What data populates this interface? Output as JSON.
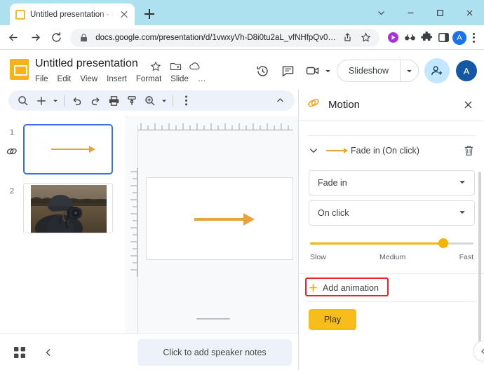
{
  "browser": {
    "tab": {
      "title": "Untitled presentation - Google S",
      "favicon_icon": "slides-favicon",
      "close_icon": "close-icon"
    },
    "new_tab_icon": "plus-icon",
    "window_controls": [
      {
        "name": "tab-search",
        "icon": "chevron-down-icon"
      },
      {
        "name": "minimize",
        "icon": "minimize-icon"
      },
      {
        "name": "maximize",
        "icon": "maximize-icon"
      },
      {
        "name": "close",
        "icon": "close-icon"
      }
    ],
    "nav": {
      "back_icon": "arrow-left-icon",
      "forward_icon": "arrow-right-icon",
      "reload_icon": "reload-icon"
    },
    "omnibox": {
      "lock_icon": "lock-icon",
      "url": "docs.google.com/presentation/d/1vwxyVh-D8i0tu2aL_vfNHfpQv0…",
      "share_icon": "share-icon",
      "bookmark_icon": "star-icon"
    },
    "extensions": [
      {
        "name": "media-extension",
        "icon": "play-circle-icon",
        "color": "#a730e0"
      },
      {
        "name": "accessibility-extension",
        "icon": "glasses-icon",
        "color": "#3c4043"
      },
      {
        "name": "extensions-puzzle",
        "icon": "puzzle-icon",
        "color": "#3c4043"
      },
      {
        "name": "side-panel",
        "icon": "panel-icon",
        "color": "#3c4043"
      }
    ],
    "profile_avatar": "A",
    "menu_icon": "kebab-icon"
  },
  "app_header": {
    "logo_icon": "google-slides-logo",
    "doc_title": "Untitled presentation",
    "title_icons": [
      {
        "name": "star-icon",
        "label": "Star"
      },
      {
        "name": "move-to-folder-icon",
        "label": "Move"
      },
      {
        "name": "cloud-saved-icon",
        "label": "Saved to Drive"
      }
    ],
    "menus": [
      "File",
      "Edit",
      "View",
      "Insert",
      "Format",
      "Slide",
      "…"
    ],
    "right_icons": [
      {
        "name": "version-history-icon",
        "label": "Version history"
      },
      {
        "name": "comment-icon",
        "label": "Comments"
      },
      {
        "name": "meet-camera-icon",
        "label": "Join a call"
      }
    ],
    "slideshow": {
      "label": "Slideshow",
      "dropdown_icon": "chevron-down-icon"
    },
    "share_button": {
      "name": "share-button",
      "icon": "person-add-icon"
    },
    "account_avatar": "A"
  },
  "slides_toolbar": {
    "items": [
      {
        "name": "search-icon",
        "label": "Search the menus"
      },
      {
        "name": "new-slide-icon",
        "label": "New slide"
      },
      {
        "name": "new-slide-dropdown-icon",
        "label": "New slide options"
      },
      {
        "name": "undo-icon",
        "label": "Undo"
      },
      {
        "name": "redo-icon",
        "label": "Redo"
      },
      {
        "name": "print-icon",
        "label": "Print"
      },
      {
        "name": "paint-format-icon",
        "label": "Paint format"
      },
      {
        "name": "zoom-icon",
        "label": "Zoom"
      },
      {
        "name": "zoom-dropdown-icon",
        "label": "Zoom options"
      },
      {
        "name": "more-options-icon",
        "label": "More"
      }
    ],
    "collapse_icon": "chevron-up-icon"
  },
  "filmstrip": {
    "slides": [
      {
        "number": "1",
        "selected": true,
        "has_transition_icon": true,
        "content": "orange-arrow"
      },
      {
        "number": "2",
        "selected": false,
        "has_transition_icon": false,
        "content": "photographer-photo"
      }
    ]
  },
  "canvas": {
    "shape": "orange-arrow",
    "ruler_horizontal": true,
    "ruler_vertical": true
  },
  "notes": {
    "grid_view_icon": "grid-view-icon",
    "collapse_icon": "chevron-left-icon",
    "placeholder": "Click to add speaker notes"
  },
  "motion_panel": {
    "icon": "motion-icon",
    "title": "Motion",
    "close_icon": "close-icon",
    "animation": {
      "caret_icon": "chevron-down-icon",
      "arrow_icon": "arrow-right-icon",
      "label": "Fade in  (On click)",
      "delete_icon": "trash-icon"
    },
    "effect_select": {
      "value": "Fade in",
      "caret_icon": "chevron-down-icon"
    },
    "trigger_select": {
      "value": "On click",
      "caret_icon": "chevron-down-icon"
    },
    "speed_slider": {
      "min_label": "Slow",
      "mid_label": "Medium",
      "max_label": "Fast",
      "value_percent": 80,
      "fill_color": "#f4b400"
    },
    "add_animation": {
      "label": "Add animation",
      "plus_icon": "plus-icon",
      "highlighted": true,
      "highlight_color": "#e8262a"
    },
    "play_button": {
      "label": "Play",
      "color": "#f6bd1d"
    },
    "collapse_icon": "chevron-left-icon"
  }
}
